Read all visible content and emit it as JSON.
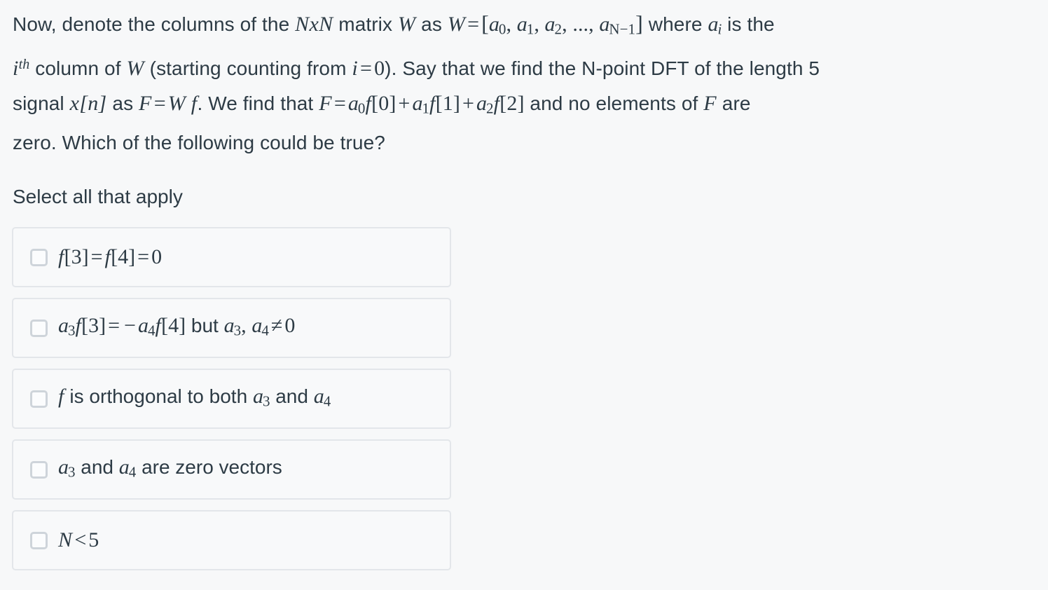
{
  "question": {
    "stem_plain": "Now, denote the columns of the NxN matrix W as W = [a0, a1, a2, ..., aN−1] where ai is the ith column of W (starting counting from i = 0). Say that we find the N-point DFT of the length 5 signal x[n] as F = W f. We find that F = a0 f[0] + a1 f[1] + a2 f[2] and no elements of F are zero. Which of the following could be true?",
    "line1_a": "Now, denote the columns of the ",
    "line1_matrix": "NxN",
    "line1_b": " matrix ",
    "line1_W": "W",
    "line1_c": " as ",
    "line1_W2": "W",
    "line1_eq": "=",
    "line1_open": "[",
    "line1_a0": "a",
    "line1_a0sub": "0",
    "line1_comma1": ", ",
    "line1_a1": "a",
    "line1_a1sub": "1",
    "line1_comma2": ", ",
    "line1_a2": "a",
    "line1_a2sub": "2",
    "line1_comma3": ", ..., ",
    "line1_aN": "a",
    "line1_aNsub": "N−1",
    "line1_close": "]",
    "line1_d": " where ",
    "line1_ai": "a",
    "line1_aisub": "i",
    "line1_e": " is the",
    "line2_i": "i",
    "line2_th": "th",
    "line2_a": " column of ",
    "line2_W": "W",
    "line2_b": " (starting counting from ",
    "line2_i2": "i",
    "line2_eq": "=",
    "line2_zero": "0",
    "line2_c": ").  Say that we find the N-point DFT of the length 5",
    "line3_a": "signal ",
    "line3_x": "x",
    "line3_xn": "[n]",
    "line3_b": " as ",
    "line3_F": "F",
    "line3_eq1": "=",
    "line3_Wf": "W f",
    "line3_c": ".  We find that ",
    "line3_F2": "F",
    "line3_eq2": "=",
    "line3_t1a": "a",
    "line3_t1s": "0",
    "line3_t1f": "f",
    "line3_t1b": "[0]",
    "line3_plus1": "+",
    "line3_t2a": "a",
    "line3_t2s": "1",
    "line3_t2f": "f",
    "line3_t2b": "[1]",
    "line3_plus2": "+",
    "line3_t3a": "a",
    "line3_t3s": "2",
    "line3_t3f": "f",
    "line3_t3b": "[2]",
    "line3_d": " and no elements of ",
    "line3_F3": "F",
    "line3_e": " are",
    "line4": "zero.  Which of the following could be true?"
  },
  "instruction": {
    "label": "Select all that apply"
  },
  "options": [
    {
      "id": "option-1",
      "text_plain": "f[3] = f[4] = 0",
      "checked": false,
      "parts": {
        "f1": "f",
        "b1": "[3]",
        "eq1": "=",
        "f2": "f",
        "b2": "[4]",
        "eq2": "=",
        "zero": "0"
      }
    },
    {
      "id": "option-2",
      "text_plain": "a3 f[3] = −a4 f[4] but a3, a4 ≠ 0",
      "checked": false,
      "parts": {
        "a1": "a",
        "a1s": "3",
        "f1": "f",
        "b1": "[3]",
        "eq": "=",
        "minus": "−",
        "a2": "a",
        "a2s": "4",
        "f2": "f",
        "b2": "[4]",
        "but": "but",
        "a3": "a",
        "a3s": "3",
        "comma": ",",
        "a4": "a",
        "a4s": "4",
        "neq": "≠",
        "zero": "0"
      }
    },
    {
      "id": "option-3",
      "text_plain": "f is orthogonal to both a3 and a4",
      "checked": false,
      "parts": {
        "f": "f",
        "mid": "is orthogonal to both",
        "a1": "a",
        "a1s": "3",
        "and": "and",
        "a2": "a",
        "a2s": "4"
      }
    },
    {
      "id": "option-4",
      "text_plain": "a3 and a4 are zero vectors",
      "checked": false,
      "parts": {
        "a1": "a",
        "a1s": "3",
        "and": "and",
        "a2": "a",
        "a2s": "4",
        "tail": "are zero vectors"
      }
    },
    {
      "id": "option-5",
      "text_plain": "N < 5",
      "checked": false,
      "parts": {
        "N": "N",
        "lt": "<",
        "five": "5"
      }
    }
  ],
  "colors": {
    "background": "#f7f8f9",
    "text": "#2d3b45",
    "option_border": "#e3e6ea",
    "option_background": "#f8f9fa",
    "checkbox_border": "#ced4da"
  }
}
